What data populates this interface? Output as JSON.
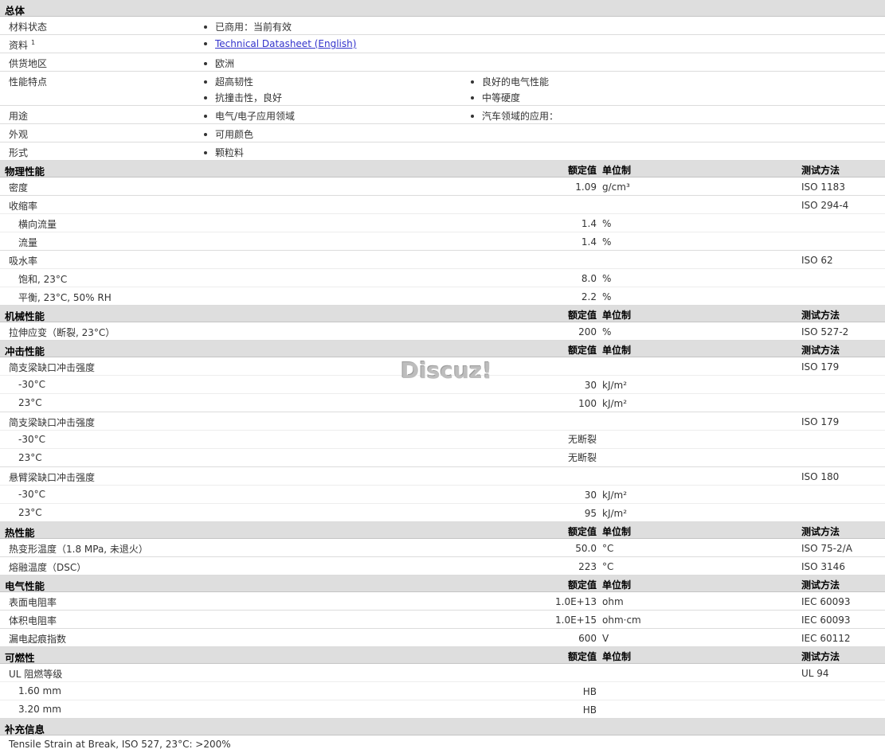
{
  "general": {
    "title": "总体",
    "status_label": "材料状态",
    "status_value": "已商用：当前有效",
    "doc_label": "资料",
    "doc_sup": "1",
    "doc_link": "Technical Datasheet (English)",
    "region_label": "供货地区",
    "region_value": "欧洲",
    "features_label": "性能特点",
    "features": [
      "超高韧性",
      "良好的电气性能",
      "抗撞击性，良好",
      "中等硬度"
    ],
    "uses_label": "用途",
    "uses": [
      "电气/电子应用领域",
      "汽车领域的应用："
    ],
    "appearance_label": "外观",
    "appearance_value": "可用颜色",
    "form_label": "形式",
    "form_value": "颗粒料"
  },
  "headers": {
    "value": "额定值",
    "unit": "单位制",
    "method": "测试方法"
  },
  "sections": {
    "physical": "物理性能",
    "mechanical": "机械性能",
    "impact": "冲击性能",
    "thermal": "热性能",
    "electrical": "电气性能",
    "flammability": "可燃性",
    "additional": "补充信息"
  },
  "physical": {
    "density": {
      "label": "密度",
      "value": "1.09",
      "unit": "g/cm³",
      "method": "ISO 1183"
    },
    "shrink": {
      "label": "收缩率",
      "method": "ISO 294-4"
    },
    "shrink_cross": {
      "label": "横向流量",
      "value": "1.4",
      "unit": "%"
    },
    "shrink_flow": {
      "label": "流量",
      "value": "1.4",
      "unit": "%"
    },
    "water": {
      "label": "吸水率",
      "method": "ISO 62"
    },
    "water_sat": {
      "label": "饱和, 23°C",
      "value": "8.0",
      "unit": "%"
    },
    "water_eq": {
      "label": "平衡, 23°C, 50% RH",
      "value": "2.2",
      "unit": "%"
    }
  },
  "mechanical": {
    "strain": {
      "label": "拉伸应变（断裂, 23°C）",
      "value": "200",
      "unit": "%",
      "method": "ISO 527-2"
    }
  },
  "impact": {
    "charpy_notched": {
      "label": "简支梁缺口冲击强度",
      "method": "ISO 179"
    },
    "cn_m30": {
      "label": "-30°C",
      "value": "30",
      "unit": "kJ/m²"
    },
    "cn_23": {
      "label": "23°C",
      "value": "100",
      "unit": "kJ/m²"
    },
    "charpy_unnotched": {
      "label": "简支梁缺口冲击强度",
      "method": "ISO 179"
    },
    "cu_m30": {
      "label": "-30°C",
      "value": "无断裂"
    },
    "cu_23": {
      "label": "23°C",
      "value": "无断裂"
    },
    "izod": {
      "label": "悬臂梁缺口冲击强度",
      "method": "ISO 180"
    },
    "iz_m30": {
      "label": "-30°C",
      "value": "30",
      "unit": "kJ/m²"
    },
    "iz_23": {
      "label": "23°C",
      "value": "95",
      "unit": "kJ/m²"
    }
  },
  "thermal": {
    "hdt": {
      "label": "热变形温度（1.8 MPa, 未退火）",
      "value": "50.0",
      "unit": "°C",
      "method": "ISO 75-2/A"
    },
    "melt": {
      "label": "熔融温度（DSC）",
      "value": "223",
      "unit": "°C",
      "method": "ISO 3146"
    }
  },
  "electrical": {
    "surface": {
      "label": "表面电阻率",
      "value": "1.0E+13",
      "unit": "ohm",
      "method": "IEC 60093"
    },
    "volume": {
      "label": "体积电阻率",
      "value": "1.0E+15",
      "unit": "ohm·cm",
      "method": "IEC 60093"
    },
    "cti": {
      "label": "漏电起痕指数",
      "value": "600",
      "unit": "V",
      "method": "IEC 60112"
    }
  },
  "flammability": {
    "ul": {
      "label": "UL 阻燃等级",
      "method": "UL 94"
    },
    "ul_160": {
      "label": "1.60 mm",
      "value": "HB"
    },
    "ul_320": {
      "label": "3.20 mm",
      "value": "HB"
    }
  },
  "additional": {
    "note": "Tensile Strain at Break, ISO 527, 23°C: >200%"
  },
  "watermark": "Discuz!"
}
